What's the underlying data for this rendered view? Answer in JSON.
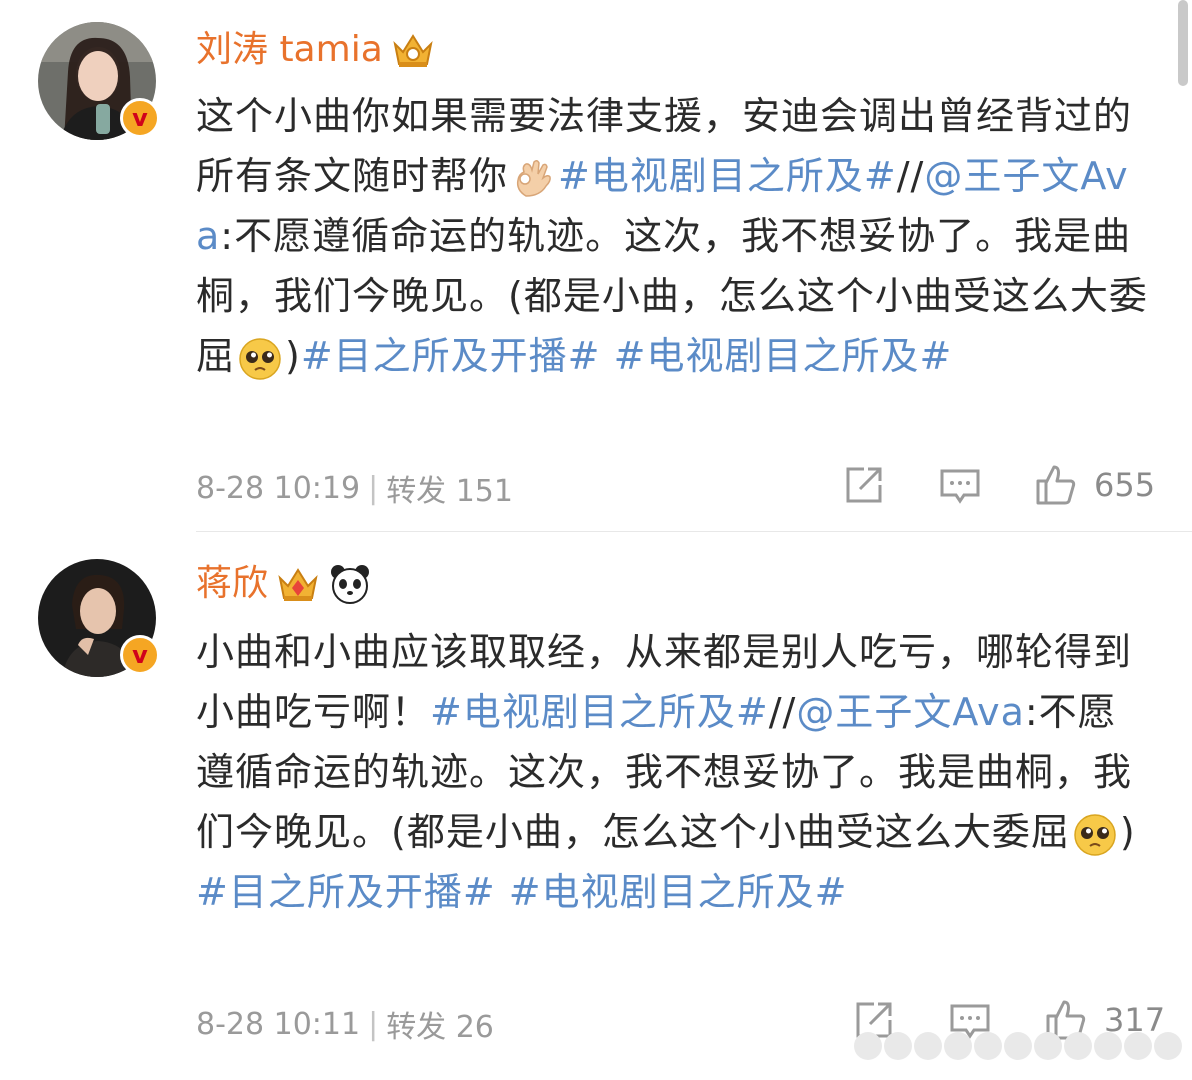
{
  "colors": {
    "username": "#e8722c",
    "link": "#5b8bc7",
    "text": "#2b2b2b",
    "meta": "#9a9a9a"
  },
  "posts": [
    {
      "username": "刘涛 tamia",
      "badges": [
        "crown-badge-icon"
      ],
      "content": {
        "t1": "这个小曲你如果需要法律支援，安迪会调出曾经背过的所有条文随时帮你",
        "e1": "ok-hand-emoji",
        "l1": "#电视剧目之所及#",
        "t2": "//",
        "l2": "@王子文Ava",
        "t3": ":不愿遵循命运的轨迹。这次，我不想妥协了。我是曲桐，我们今晚见。(都是小曲，怎么这个小曲受这么大委屈",
        "e2": "pleading-face-emoji",
        "t4": ")",
        "l3": "#目之所及开播#",
        "t5": " ",
        "l4": "#电视剧目之所及#"
      },
      "time": "8-28 10:19",
      "repost_label": "转发 151",
      "likes": "655"
    },
    {
      "username": "蒋欣",
      "badges": [
        "crown-badge-icon",
        "panda-icon"
      ],
      "content": {
        "t1": "小曲和小曲应该取取经，从来都是别人吃亏，哪轮得到小曲吃亏啊！",
        "e1": "",
        "l1": "#电视剧目之所及#",
        "t2": "//",
        "l2": "@王子文Ava",
        "t3": ":不愿遵循命运的轨迹。这次，我不想妥协了。我是曲桐，我们今晚见。(都是小曲，怎么这个小曲受这么大委屈",
        "e2": "pleading-face-emoji",
        "t4": ")",
        "l3": "#目之所及开播#",
        "t5": " ",
        "l4": "#电视剧目之所及#"
      },
      "time": "8-28 10:11",
      "repost_label": "转发 26",
      "likes": "317"
    }
  ]
}
